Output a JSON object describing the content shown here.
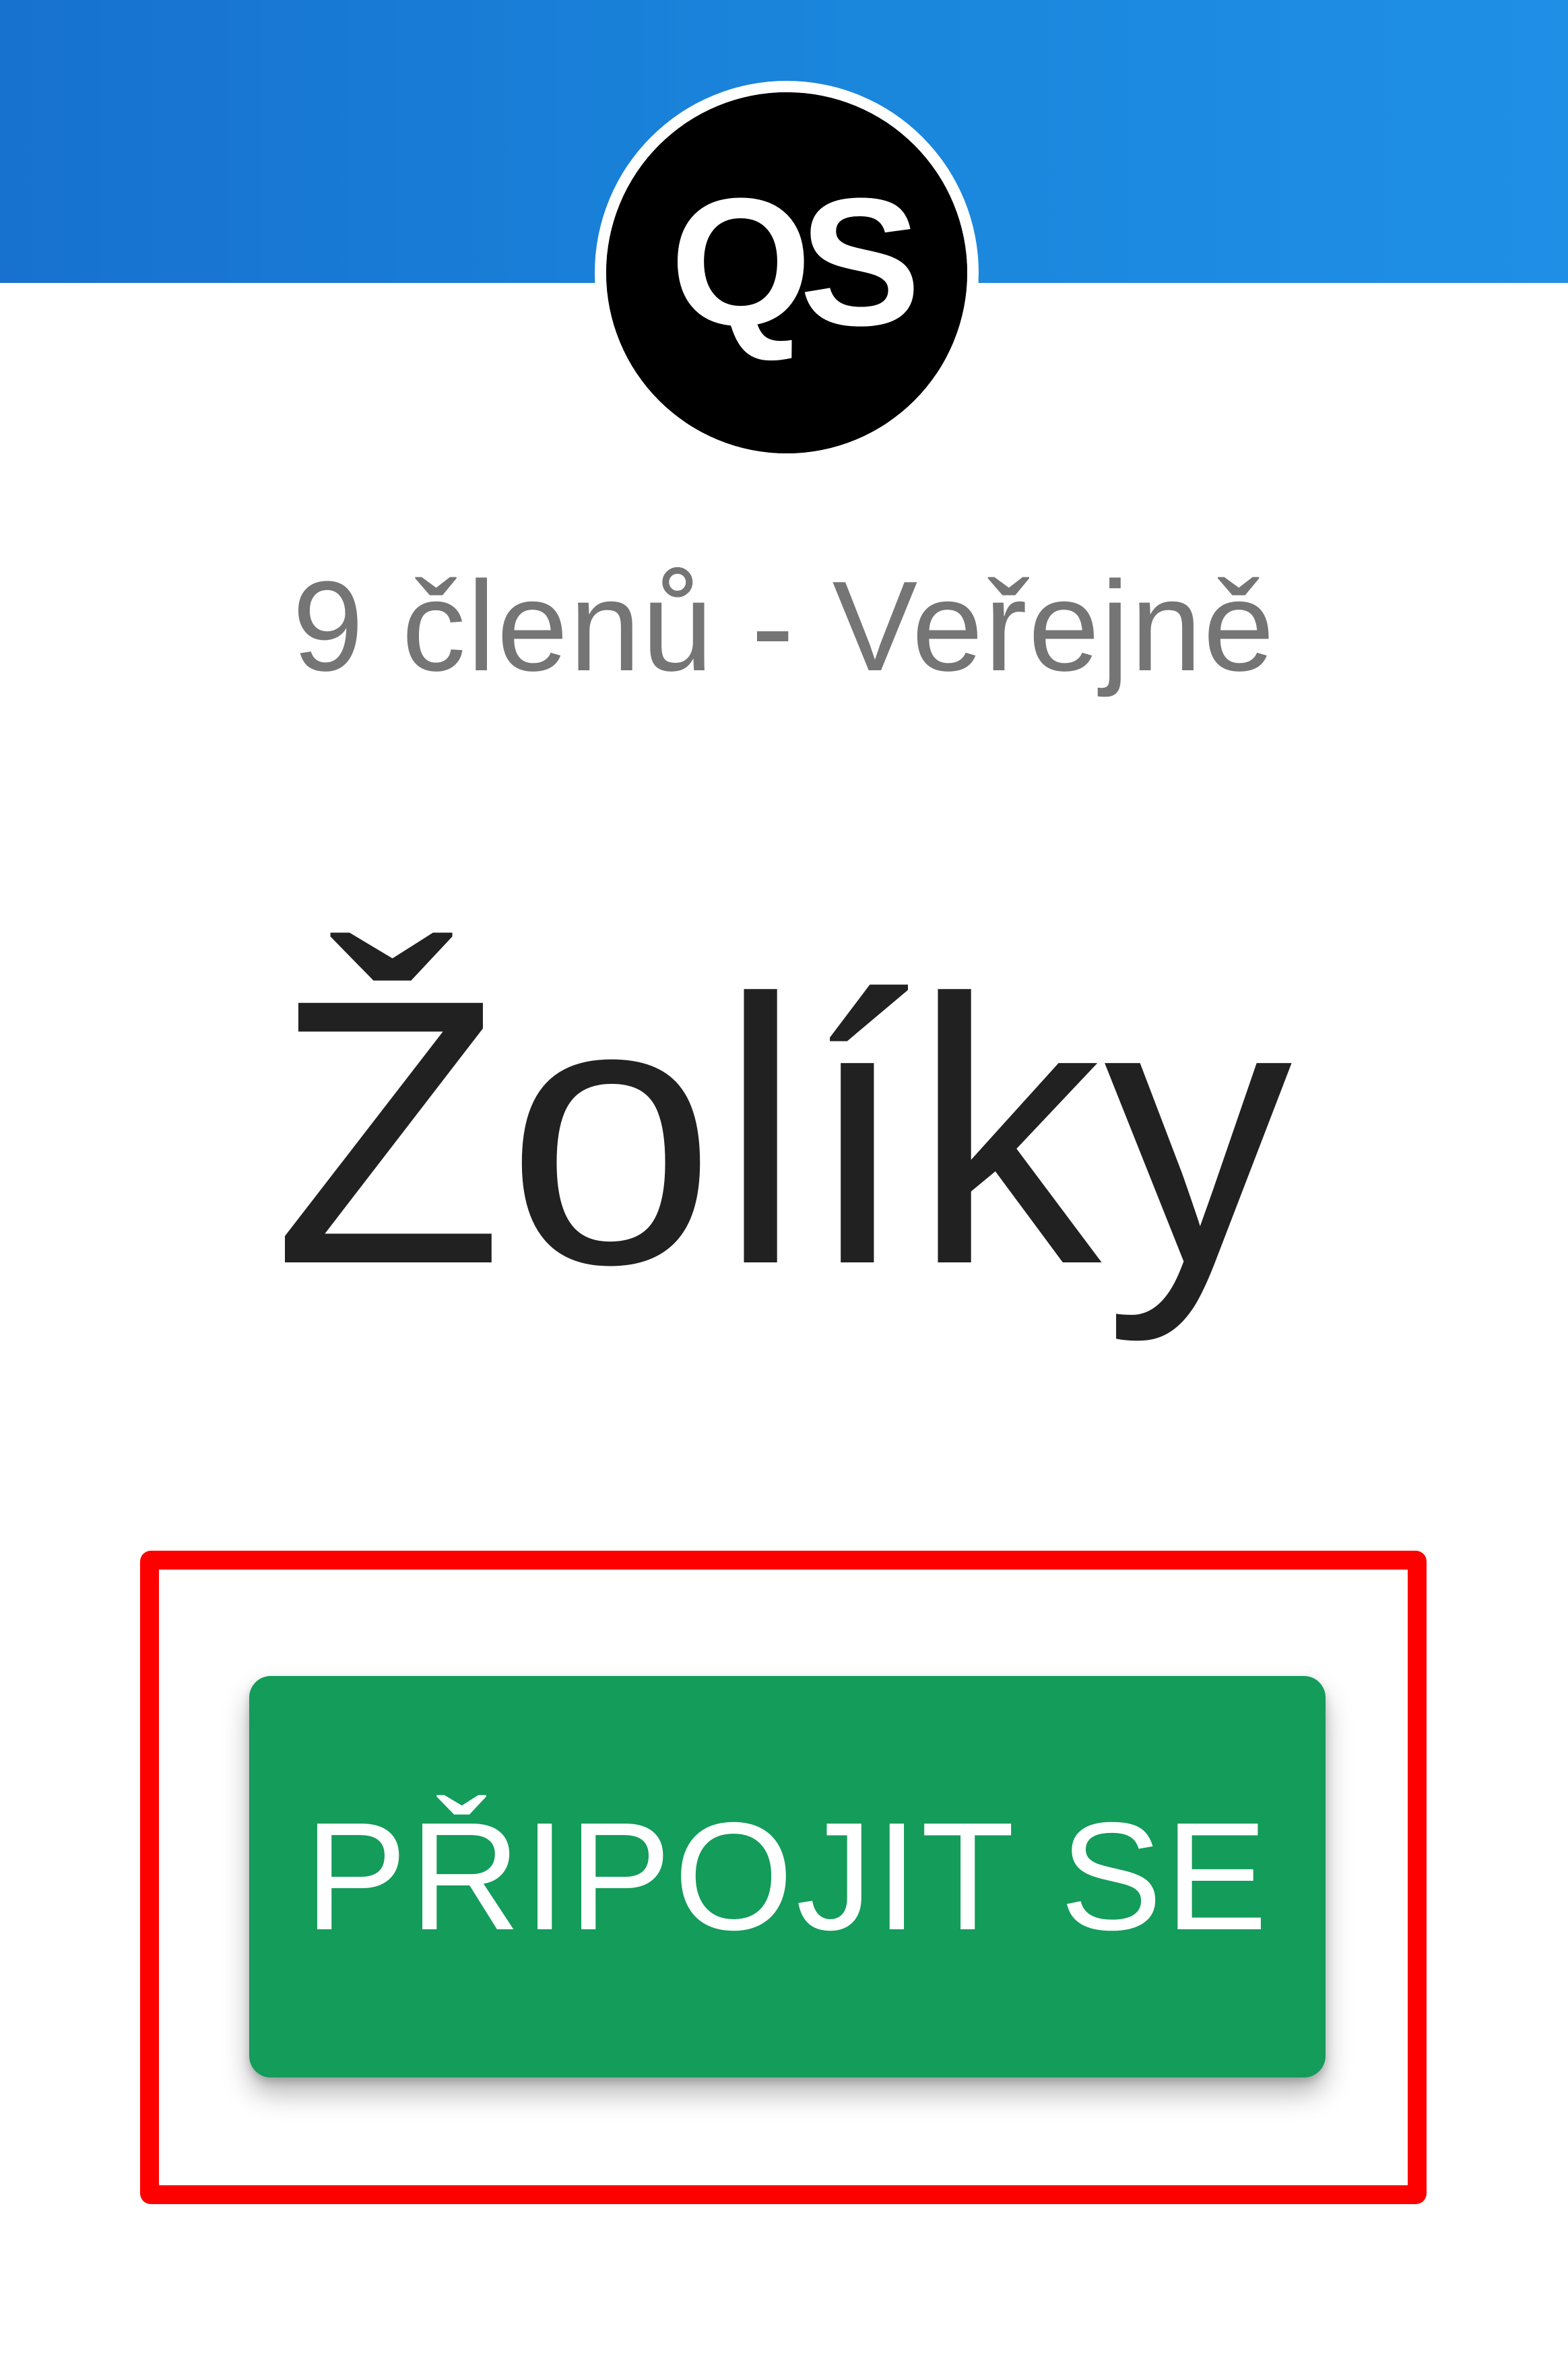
{
  "header": {
    "color": "#1a86dc"
  },
  "group": {
    "logo_text": "QS",
    "logo_background": "#000000",
    "meta": "9 členů - Veřejně",
    "title": "Žolíky"
  },
  "actions": {
    "join_label": "PŘIPOJIT SE",
    "join_color": "#139c5a",
    "highlight_color": "#ff0000"
  }
}
